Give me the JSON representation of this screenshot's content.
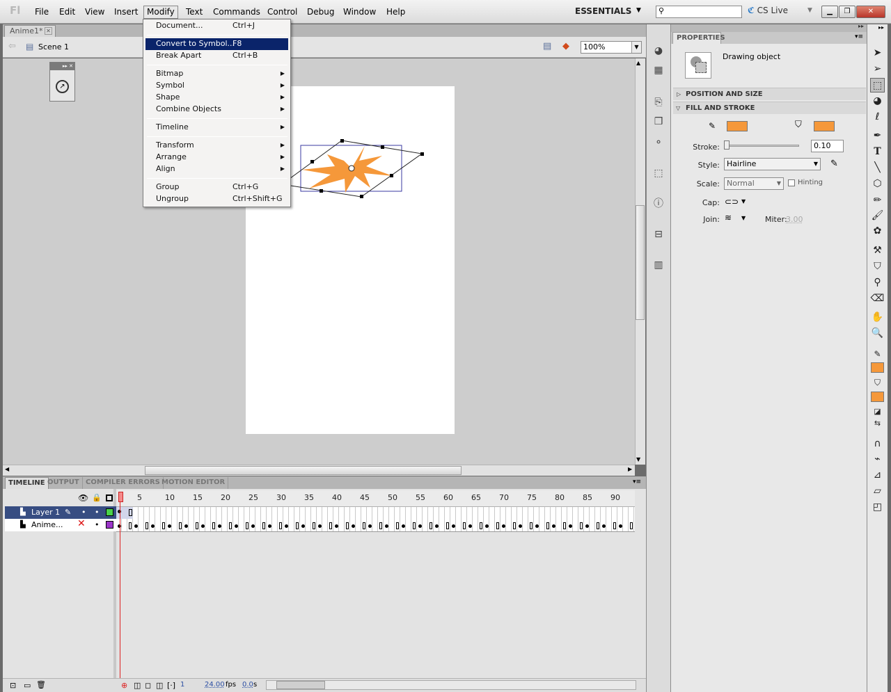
{
  "app": {
    "logo": "Fl"
  },
  "menubar": {
    "items": [
      "File",
      "Edit",
      "View",
      "Insert",
      "Modify",
      "Text",
      "Commands",
      "Control",
      "Debug",
      "Window",
      "Help"
    ],
    "workspace": "ESSENTIALS",
    "cs_live": "CS Live"
  },
  "document": {
    "tab": "Anime1*",
    "scene": "Scene 1",
    "zoom": "100%"
  },
  "modify_menu": {
    "items": [
      {
        "label": "Document...",
        "shortcut": "Ctrl+J"
      },
      {
        "label": "Convert to Symbol...",
        "shortcut": "F8"
      },
      {
        "label": "Break Apart",
        "shortcut": "Ctrl+B"
      },
      {
        "label": "Bitmap"
      },
      {
        "label": "Symbol"
      },
      {
        "label": "Shape"
      },
      {
        "label": "Combine Objects"
      },
      {
        "label": "Timeline"
      },
      {
        "label": "Transform"
      },
      {
        "label": "Arrange"
      },
      {
        "label": "Align"
      },
      {
        "label": "Group",
        "shortcut": "Ctrl+G"
      },
      {
        "label": "Ungroup",
        "shortcut": "Ctrl+Shift+G"
      }
    ]
  },
  "properties": {
    "tab": "PROPERTIES",
    "object_type": "Drawing object",
    "sections": {
      "position": "POSITION AND SIZE",
      "fill": "FILL AND STROKE"
    },
    "stroke_label": "Stroke:",
    "stroke_value": "0.10",
    "style_label": "Style:",
    "style_value": "Hairline",
    "scale_label": "Scale:",
    "scale_value": "Normal",
    "hinting_label": "Hinting",
    "cap_label": "Cap:",
    "join_label": "Join:",
    "miter_label": "Miter:",
    "miter_value": "3.00",
    "stroke_color": "#f5983a",
    "fill_color": "#f5983a"
  },
  "timeline": {
    "tabs": [
      "TIMELINE",
      "OUTPUT",
      "COMPILER ERRORS",
      "MOTION EDITOR"
    ],
    "ruler": [
      "5",
      "10",
      "15",
      "20",
      "25",
      "30",
      "35",
      "40",
      "45",
      "50",
      "55",
      "60",
      "65",
      "70",
      "75",
      "80",
      "85",
      "90"
    ],
    "layers": [
      {
        "name": "Layer 1",
        "color": "#4ad24a"
      },
      {
        "name": "Anime...",
        "color": "#9b35c8"
      }
    ],
    "current_frame": "1",
    "fps": "24.00",
    "fps_unit": "fps",
    "time": "0.0",
    "time_unit": "s"
  }
}
